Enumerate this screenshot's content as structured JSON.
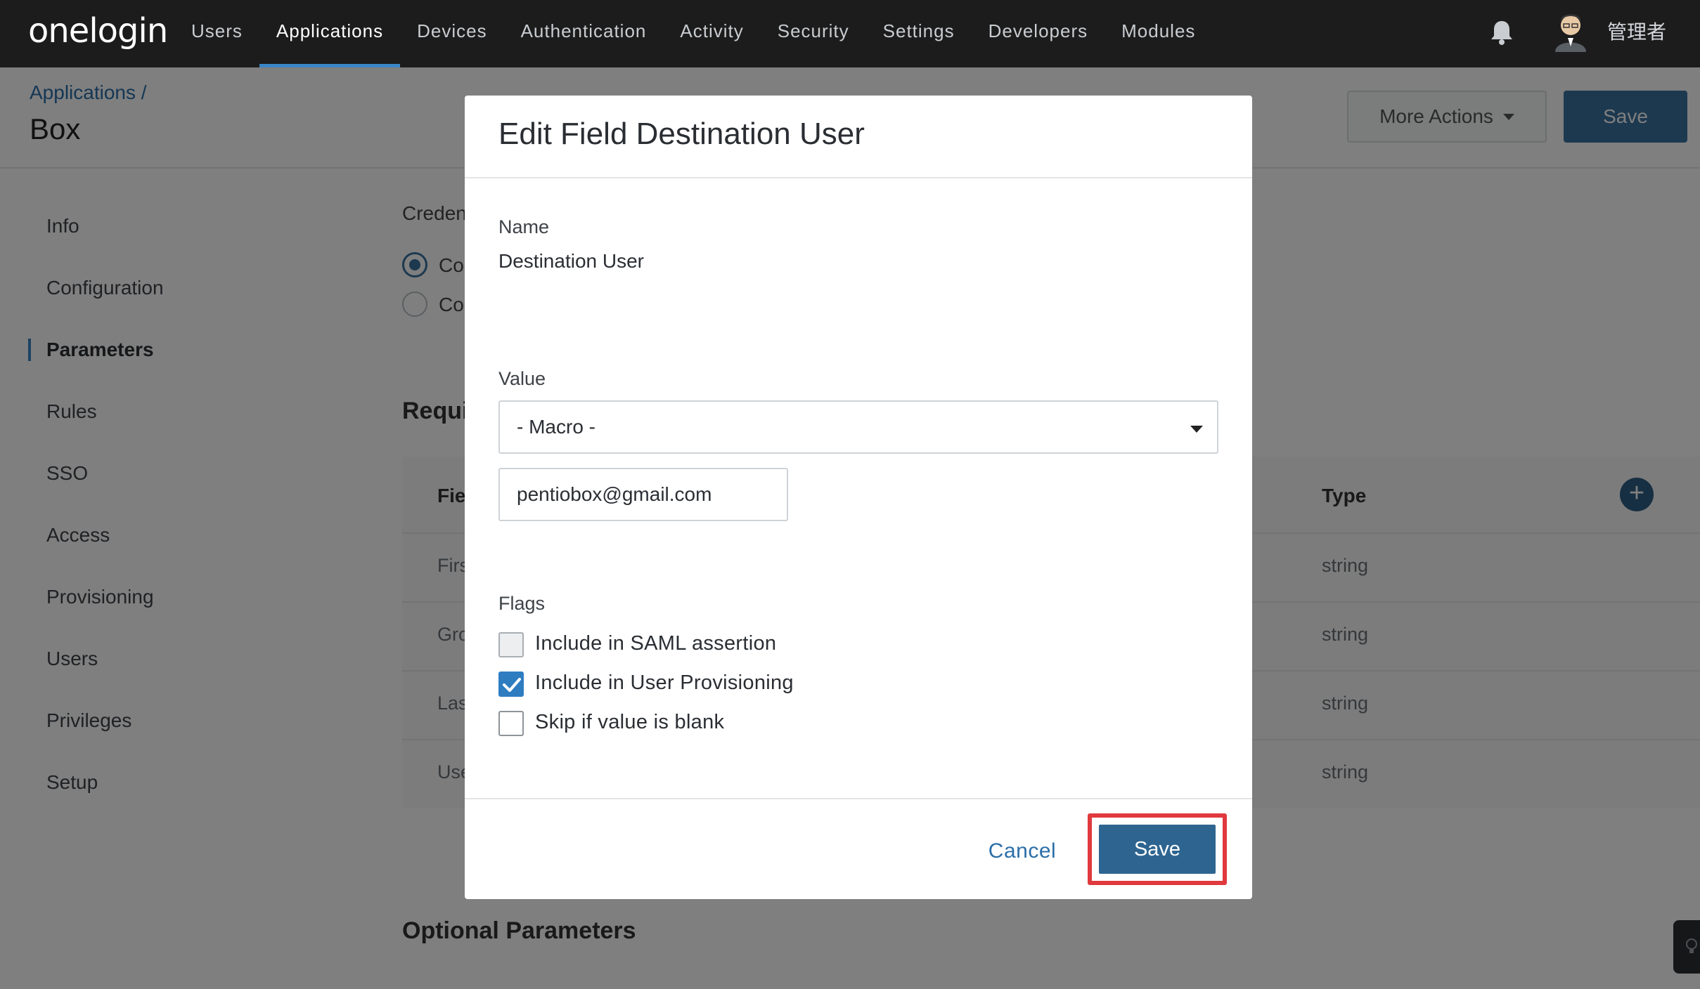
{
  "nav": {
    "logo": "onelogin",
    "items": [
      {
        "label": "Users"
      },
      {
        "label": "Applications"
      },
      {
        "label": "Devices"
      },
      {
        "label": "Authentication"
      },
      {
        "label": "Activity"
      },
      {
        "label": "Security"
      },
      {
        "label": "Settings"
      },
      {
        "label": "Developers"
      },
      {
        "label": "Modules"
      }
    ],
    "active": "Applications",
    "user_name": "管理者"
  },
  "header": {
    "breadcrumb": "Applications /",
    "title": "Box",
    "more_actions_label": "More Actions",
    "save_label": "Save"
  },
  "sidebar": {
    "items": [
      {
        "label": "Info"
      },
      {
        "label": "Configuration"
      },
      {
        "label": "Parameters"
      },
      {
        "label": "Rules"
      },
      {
        "label": "SSO"
      },
      {
        "label": "Access"
      },
      {
        "label": "Provisioning"
      },
      {
        "label": "Users"
      },
      {
        "label": "Privileges"
      },
      {
        "label": "Setup"
      }
    ],
    "active": "Parameters"
  },
  "main": {
    "credentials_label": "Creden",
    "radio_options": [
      {
        "label": "Co",
        "checked": true
      },
      {
        "label": "Co",
        "checked": false
      }
    ],
    "required_heading": "Requi",
    "table": {
      "columns": [
        "Fie",
        "Type"
      ],
      "rows": [
        {
          "field": "Firs",
          "type": "string"
        },
        {
          "field": "Gro",
          "type": "string"
        },
        {
          "field": "Las",
          "type": "string"
        },
        {
          "field": "Use",
          "type": "string"
        }
      ]
    },
    "optional_heading": "Optional Parameters"
  },
  "modal": {
    "title": "Edit Field Destination User",
    "name_label": "Name",
    "name_value": "Destination User",
    "value_label": "Value",
    "value_select": "- Macro -",
    "macro_input_value": "pentiobox@gmail.com",
    "flags_label": "Flags",
    "flags": [
      {
        "label": "Include in SAML assertion",
        "checked": false,
        "disabled": true
      },
      {
        "label": "Include in User Provisioning",
        "checked": true,
        "disabled": false
      },
      {
        "label": "Skip if value is blank",
        "checked": false,
        "disabled": false
      }
    ],
    "cancel_label": "Cancel",
    "save_label": "Save"
  },
  "colors": {
    "topbar": "#1c1c1c",
    "accent": "#2e6590",
    "link": "#2b6ea8",
    "highlight": "#e03a3e"
  }
}
